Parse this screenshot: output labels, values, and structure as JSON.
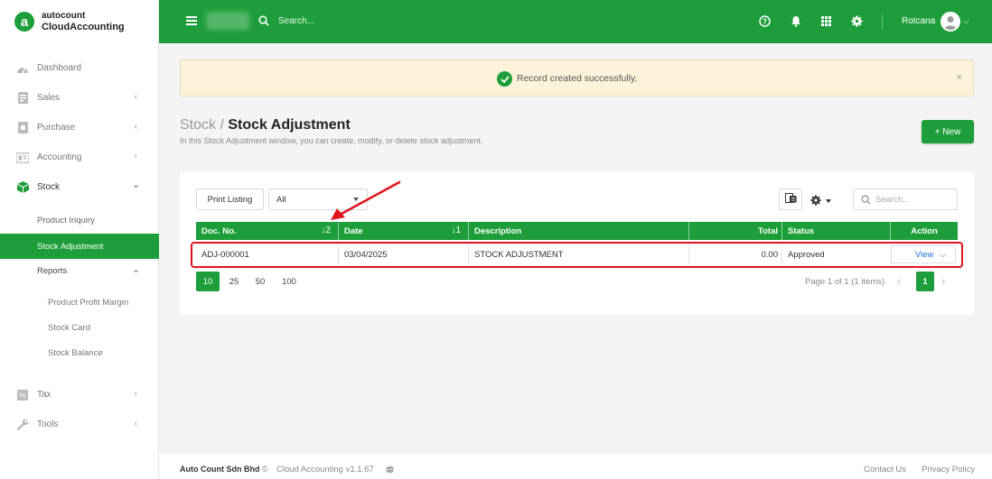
{
  "brand": {
    "top": "autocount",
    "bottom": "CloudAccounting",
    "logo_letter": "a"
  },
  "sidebar": {
    "items": [
      {
        "label": "Dashboard",
        "icon": "dashboard-icon"
      },
      {
        "label": "Sales",
        "icon": "sales-icon"
      },
      {
        "label": "Purchase",
        "icon": "purchase-icon"
      },
      {
        "label": "Accounting",
        "icon": "accounting-icon"
      },
      {
        "label": "Stock",
        "icon": "stock-icon"
      }
    ],
    "stock_sub": [
      {
        "label": "Product Inquiry"
      },
      {
        "label": "Stock Adjustment"
      },
      {
        "label": "Reports"
      }
    ],
    "reports_sub": [
      {
        "label": "Product Profit Margin"
      },
      {
        "label": "Stock Card"
      },
      {
        "label": "Stock Balance"
      }
    ],
    "bottom_items": [
      {
        "label": "Tax",
        "icon": "tax-icon"
      },
      {
        "label": "Tools",
        "icon": "tools-icon"
      }
    ]
  },
  "topbar": {
    "search_placeholder": "Search...",
    "user_name": "Rotcana"
  },
  "alert": {
    "message": "Record created successfully.",
    "close": "×"
  },
  "page": {
    "breadcrumb": "Stock",
    "separator": " / ",
    "title": "Stock Adjustment",
    "subtitle": "In this Stock Adjustment window, you can create, modify, or delete stock adjustment.",
    "new_button": "+ New"
  },
  "toolbar": {
    "print_label": "Print Listing",
    "filter_value": "All",
    "search_placeholder": "Search..."
  },
  "table": {
    "columns": [
      {
        "label": "Doc. No.",
        "sort": "↓2"
      },
      {
        "label": "Date",
        "sort": "↓1"
      },
      {
        "label": "Description",
        "sort": ""
      },
      {
        "label": "Total",
        "sort": ""
      },
      {
        "label": "Status",
        "sort": ""
      },
      {
        "label": "Action",
        "sort": ""
      }
    ],
    "rows": [
      {
        "doc_no": "ADJ-000001",
        "date": "03/04/2025",
        "description": "STOCK ADJUSTMENT",
        "total": "0.00",
        "status": "Approved",
        "action": "View"
      }
    ]
  },
  "pagination": {
    "sizes": [
      "10",
      "25",
      "50",
      "100"
    ],
    "active_size": "10",
    "info": "Page 1 of 1 (1 items)",
    "current_page": "1"
  },
  "footer": {
    "company": "Auto Count Sdn Bhd",
    "copyright": "©",
    "version": "Cloud Accounting v1.1.67",
    "contact": "Contact Us",
    "privacy": "Privacy Policy"
  },
  "colors": {
    "brand_green": "#1e9e3a",
    "annotation_red": "#e0141e",
    "alert_bg": "#fcf3da"
  }
}
